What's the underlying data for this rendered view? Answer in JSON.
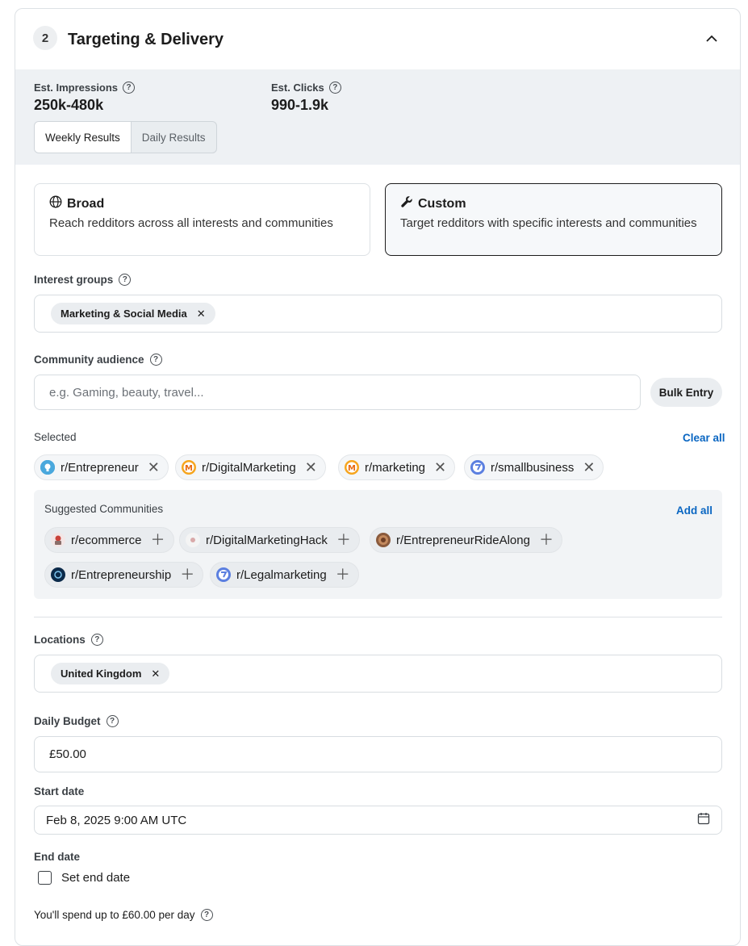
{
  "header": {
    "step": "2",
    "title": "Targeting & Delivery"
  },
  "estimates": {
    "impressions_label": "Est. Impressions",
    "impressions_value": "250k-480k",
    "clicks_label": "Est. Clicks",
    "clicks_value": "990-1.9k",
    "tabs": [
      "Weekly Results",
      "Daily Results"
    ],
    "active_tab": "Weekly Results"
  },
  "targeting": {
    "broad": {
      "title": "Broad",
      "desc": "Reach redditors across all interests and communities",
      "icon": "globe-icon"
    },
    "custom": {
      "title": "Custom",
      "desc": "Target redditors with specific interests and communities",
      "icon": "wrench-icon",
      "selected": true
    }
  },
  "interest_groups": {
    "label": "Interest groups",
    "chips": [
      "Marketing & Social Media"
    ]
  },
  "community": {
    "label": "Community audience",
    "placeholder": "e.g. Gaming, beauty, travel...",
    "bulk_label": "Bulk Entry",
    "selected_label": "Selected",
    "clear_all": "Clear all",
    "selected": [
      "r/Entrepreneur",
      "r/DigitalMarketing",
      "r/marketing",
      "r/smallbusiness"
    ],
    "suggested_label": "Suggested Communities",
    "add_all": "Add all",
    "suggested": [
      "r/ecommerce",
      "r/DigitalMarketingHack",
      "r/EntrepreneurRideAlong",
      "r/Entrepreneurship",
      "r/Legalmarketing"
    ]
  },
  "locations": {
    "label": "Locations",
    "chips": [
      "United Kingdom"
    ]
  },
  "budget": {
    "label": "Daily Budget",
    "value": "£50.00"
  },
  "start_date": {
    "label": "Start date",
    "value": "Feb 8, 2025 9:00 AM UTC"
  },
  "end_date": {
    "label": "End date",
    "checkbox_label": "Set end date",
    "checked": false
  },
  "spend_note": "You'll spend up to £60.00 per day",
  "colors": {
    "link": "#0a66c2",
    "selected_border": "#1c1c1c",
    "strip_bg": "#eef1f4"
  }
}
